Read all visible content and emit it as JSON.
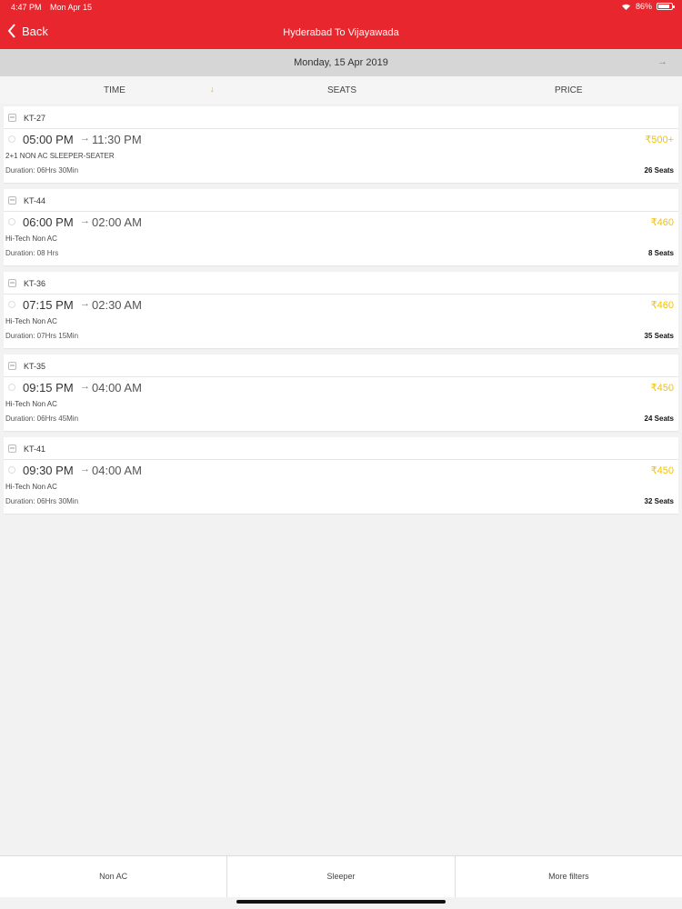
{
  "status_bar": {
    "time": "4:47 PM",
    "date": "Mon Apr 15",
    "battery": "86%"
  },
  "nav": {
    "back_label": "Back",
    "title": "Hyderabad To Vijayawada"
  },
  "date_bar": {
    "date": "Monday, 15 Apr 2019"
  },
  "sort": {
    "time": "TIME",
    "seats": "SEATS",
    "price": "PRICE",
    "active": "TIME"
  },
  "buses": [
    {
      "code": "KT-27",
      "departure": "05:00 PM",
      "arrival": "11:30 PM",
      "price": "₹500+",
      "type": "2+1 NON AC SLEEPER-SEATER",
      "duration": "Duration: 06Hrs 30Min",
      "seats": "26 Seats"
    },
    {
      "code": "KT-44",
      "departure": "06:00 PM",
      "arrival": "02:00 AM",
      "price": "₹460",
      "type": "Hi-Tech Non AC",
      "duration": "Duration: 08 Hrs",
      "seats": "8 Seats"
    },
    {
      "code": "KT-36",
      "departure": "07:15 PM",
      "arrival": "02:30 AM",
      "price": "₹460",
      "type": "Hi-Tech Non AC",
      "duration": "Duration: 07Hrs 15Min",
      "seats": "35 Seats"
    },
    {
      "code": "KT-35",
      "departure": "09:15 PM",
      "arrival": "04:00 AM",
      "price": "₹450",
      "type": "Hi-Tech Non AC",
      "duration": "Duration: 06Hrs 45Min",
      "seats": "24 Seats"
    },
    {
      "code": "KT-41",
      "departure": "09:30 PM",
      "arrival": "04:00 AM",
      "price": "₹450",
      "type": "Hi-Tech Non AC",
      "duration": "Duration: 06Hrs 30Min",
      "seats": "32 Seats"
    }
  ],
  "filters": [
    "Non AC",
    "Sleeper",
    "More filters"
  ],
  "colors": {
    "brand_red": "#e8262d",
    "price_yellow": "#f4c300",
    "sort_arrow": "#f5a300"
  }
}
